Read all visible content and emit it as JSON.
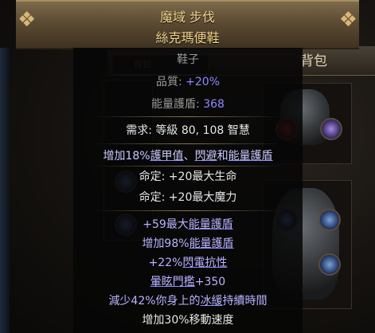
{
  "item": {
    "name": "魔域 步伐",
    "base": "絲克瑪便鞋",
    "item_class": "鞋子",
    "properties": [
      {
        "label": "品質: ",
        "value": "+20%"
      },
      {
        "label": "能量護盾: ",
        "value": "368"
      }
    ],
    "requirements": "需求: 等級 80, 108 智慧",
    "implicit_main": {
      "pre": "增加18%",
      "u1": "護甲值",
      "mid": "、",
      "u2": "閃避",
      "mid2": "和",
      "u3": "能量護盾"
    },
    "enchants": [
      "命定: +20最大生命",
      "命定: +20最大魔力"
    ],
    "explicit_mods": [
      {
        "pre": "+59最大",
        "u": "能量護盾",
        "post": ""
      },
      {
        "pre": "增加98%",
        "u": "能量護盾",
        "post": ""
      },
      {
        "pre": "+22%",
        "u": "閃電抗性",
        "post": ""
      },
      {
        "pre": "",
        "u": "暈眩門檻",
        "post": "+350"
      },
      {
        "pre": "減少42%你身上的",
        "u": "冰緩",
        "post": "持續時間"
      }
    ],
    "last_mod": "增加30%移動速度"
  },
  "background": {
    "inventory_title": "背包",
    "tab_label": "背包"
  },
  "colors": {
    "unique_name": "#f2d48a",
    "magic_mod": "#8a8afe",
    "property_value": "#8a8afe",
    "header_bg": "#5c4b33"
  }
}
